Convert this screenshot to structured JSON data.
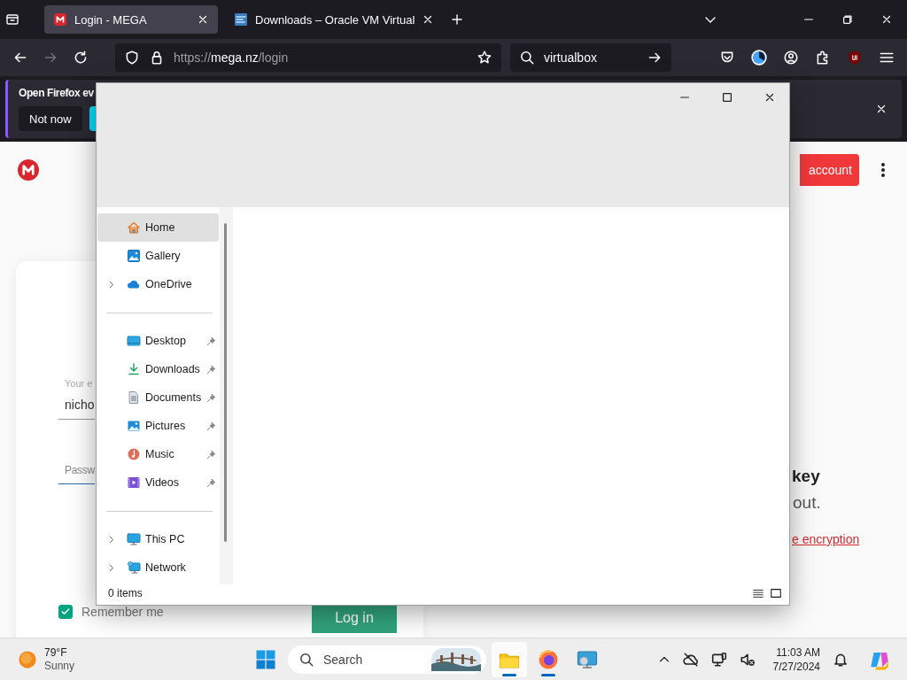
{
  "browser": {
    "tabs": [
      {
        "title": "Login - MEGA",
        "selected": true
      },
      {
        "title": "Downloads – Oracle VM Virtual",
        "selected": false
      }
    ],
    "url": "https://mega.nz/login",
    "search": {
      "value": "virtualbox"
    },
    "notification": {
      "text": "Open Firefox ev",
      "button": "Not now"
    }
  },
  "page": {
    "signup_button": "account",
    "email": {
      "label": "Your e",
      "value": "nicho"
    },
    "password": {
      "placeholder": "Passw"
    },
    "remember": {
      "label": "Remember me",
      "checked": true
    },
    "login_button": "Log in",
    "heading": "key",
    "text": "out.",
    "link": "e encryption"
  },
  "explorer": {
    "sections": [
      {
        "items": [
          {
            "label": "Home",
            "selected": true,
            "expandable": false,
            "pinned": false
          },
          {
            "label": "Gallery",
            "selected": false,
            "expandable": false,
            "pinned": false
          },
          {
            "label": "OneDrive",
            "selected": false,
            "expandable": true,
            "pinned": false
          }
        ]
      },
      {
        "items": [
          {
            "label": "Desktop",
            "selected": false,
            "expandable": false,
            "pinned": true
          },
          {
            "label": "Downloads",
            "selected": false,
            "expandable": false,
            "pinned": true
          },
          {
            "label": "Documents",
            "selected": false,
            "expandable": false,
            "pinned": true
          },
          {
            "label": "Pictures",
            "selected": false,
            "expandable": false,
            "pinned": true
          },
          {
            "label": "Music",
            "selected": false,
            "expandable": false,
            "pinned": true
          },
          {
            "label": "Videos",
            "selected": false,
            "expandable": false,
            "pinned": true
          }
        ]
      },
      {
        "items": [
          {
            "label": "This PC",
            "selected": false,
            "expandable": true,
            "pinned": false
          },
          {
            "label": "Network",
            "selected": false,
            "expandable": true,
            "pinned": false
          }
        ]
      }
    ],
    "status": "0 items"
  },
  "taskbar": {
    "weather": {
      "temp": "79°F",
      "condition": "Sunny"
    },
    "search": {
      "label": "Search"
    },
    "apps": [
      {
        "selected": true,
        "running": true
      },
      {
        "selected": false,
        "running": true
      },
      {
        "selected": false,
        "running": false
      }
    ],
    "time": "11:03 AM",
    "date": "7/27/2024"
  }
}
